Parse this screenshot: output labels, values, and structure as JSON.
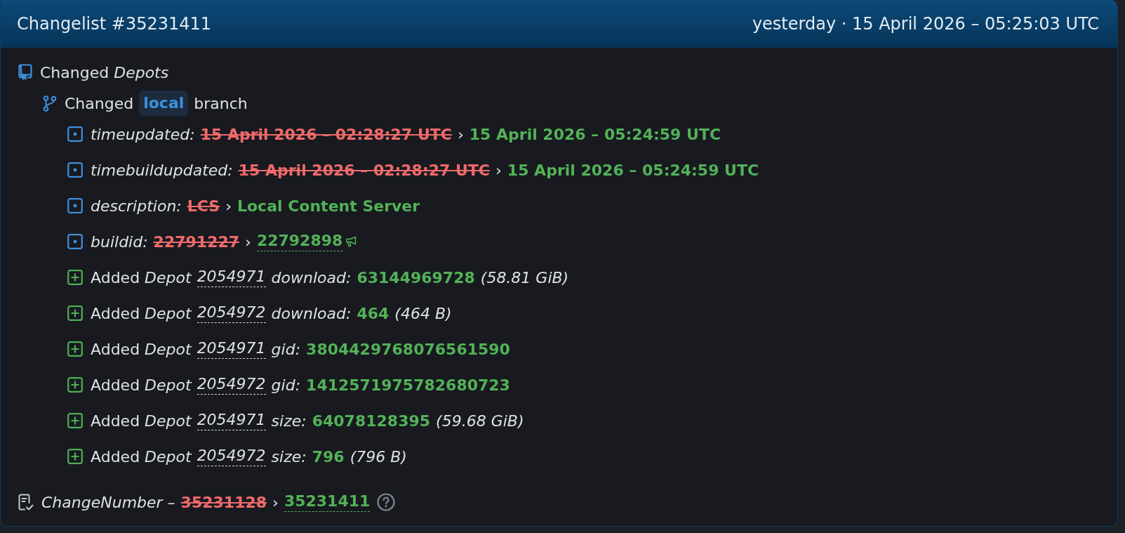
{
  "header": {
    "title": "Changelist #35231411",
    "timestamp": "yesterday · 15 April 2026 – 05:25:03 UTC"
  },
  "changes": [
    {
      "kind": "section",
      "label": "Changed *Depots*",
      "children": [
        {
          "kind": "branch",
          "verb": "Changed",
          "branch": "local",
          "noun": "branch",
          "children": [
            {
              "kind": "property",
              "key": "timeupdated:",
              "old": "15 April 2026 – 02:28:27 UTC",
              "arrow": "›",
              "new": "15 April 2026 – 05:24:59 UTC",
              "linked": false
            },
            {
              "kind": "property",
              "key": "timebuildupdated:",
              "old": "15 April 2026 – 02:28:27 UTC",
              "arrow": "›",
              "new": "15 April 2026 – 05:24:59 UTC",
              "linked": false
            },
            {
              "kind": "property",
              "key": "description:",
              "old": "LCS",
              "arrow": "›",
              "new": "Local Content Server",
              "linked": false
            },
            {
              "kind": "property",
              "key": "buildid:",
              "old": "22791227",
              "arrow": "›",
              "new": "22792898",
              "linked": true
            },
            {
              "kind": "added",
              "label": "Added *Depot*",
              "depot": "2054971",
              "key": "download:",
              "value": "63144969728",
              "note": "(58.81 GiB)"
            },
            {
              "kind": "added",
              "label": "Added *Depot*",
              "depot": "2054972",
              "key": "download:",
              "value": "464",
              "note": "(464 B)"
            },
            {
              "kind": "added",
              "label": "Added *Depot*",
              "depot": "2054971",
              "key": "gid:",
              "value": "3804429768076561590"
            },
            {
              "kind": "added",
              "label": "Added *Depot*",
              "depot": "2054972",
              "key": "gid:",
              "value": "1412571975782680723"
            },
            {
              "kind": "added",
              "label": "Added *Depot*",
              "depot": "2054971",
              "key": "size:",
              "value": "64078128395",
              "note": "(59.68 GiB)"
            },
            {
              "kind": "added",
              "label": "Added *Depot*",
              "depot": "2054972",
              "key": "size:",
              "value": "796",
              "note": "(796 B)"
            }
          ]
        }
      ]
    },
    {
      "kind": "number",
      "key": "*ChangeNumber* –",
      "old": "35231128",
      "arrow": "›",
      "new": "35231411",
      "linked": true
    }
  ]
}
